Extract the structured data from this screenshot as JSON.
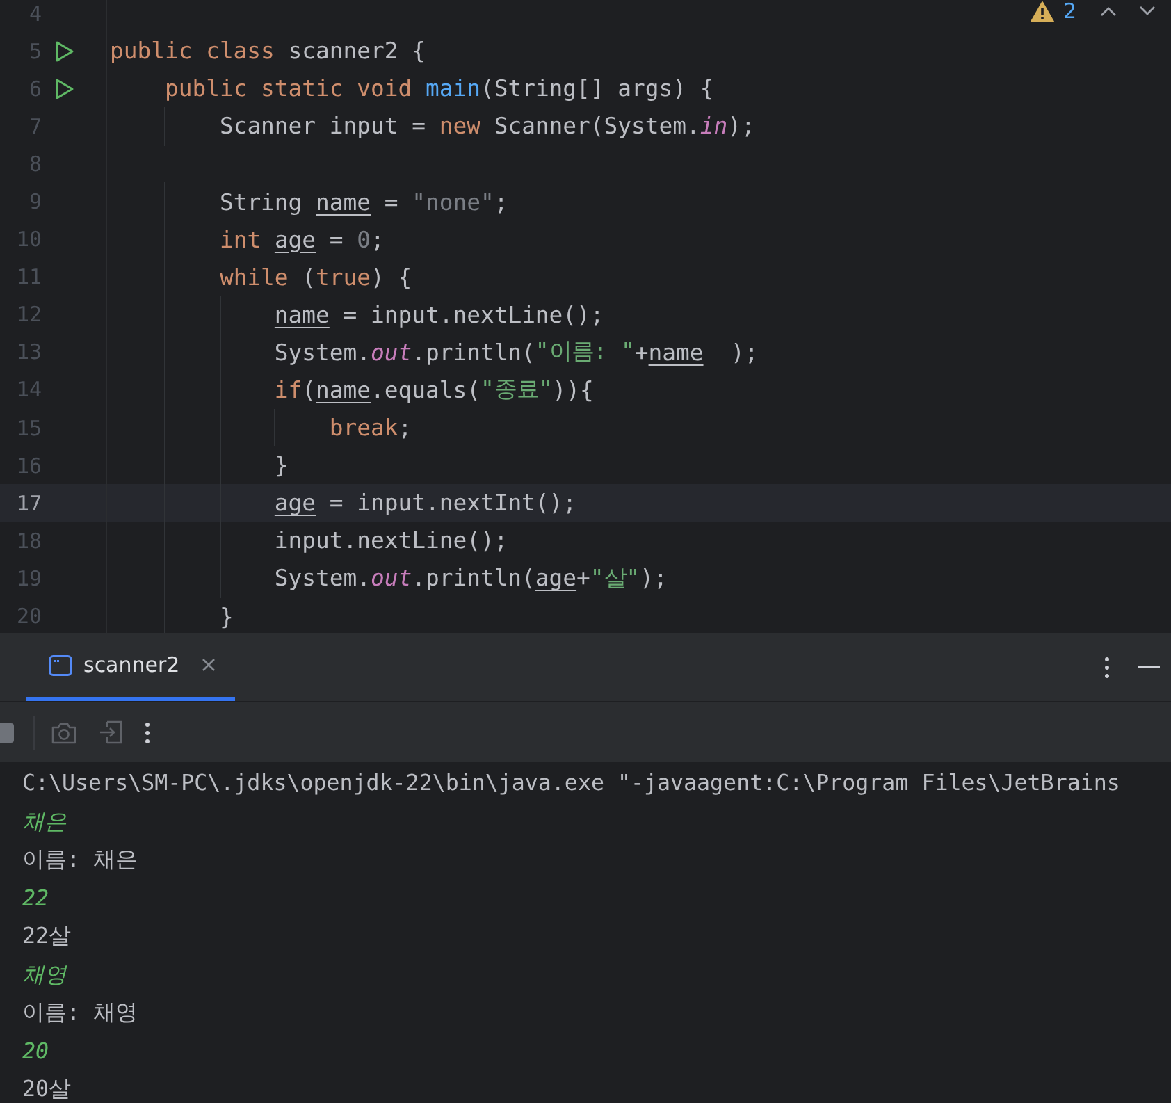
{
  "editor": {
    "inspections": {
      "warnings": "2"
    },
    "lines": [
      {
        "n": "4",
        "run": false,
        "current": false
      },
      {
        "n": "5",
        "run": true,
        "current": false,
        "tokens": [
          {
            "t": "public class ",
            "kind": "kw"
          },
          {
            "t": "scanner2 {",
            "kind": "plain"
          }
        ]
      },
      {
        "n": "6",
        "run": true,
        "current": false,
        "tokens": [
          {
            "t": "    public static void ",
            "kind": "kw"
          },
          {
            "t": "main",
            "kind": "fn"
          },
          {
            "t": "(String[] args) {",
            "kind": "plain"
          }
        ]
      },
      {
        "n": "7",
        "run": false,
        "current": false,
        "tokens": [
          {
            "t": "        Scanner input = ",
            "kind": "plain"
          },
          {
            "t": "new ",
            "kind": "kw"
          },
          {
            "t": "Scanner(System.",
            "kind": "plain"
          },
          {
            "t": "in",
            "kind": "static"
          },
          {
            "t": ");",
            "kind": "plain"
          }
        ]
      },
      {
        "n": "8",
        "run": false,
        "current": false
      },
      {
        "n": "9",
        "run": false,
        "current": false,
        "tokens": [
          {
            "t": "        String ",
            "kind": "plain"
          },
          {
            "t": "name",
            "kind": "var"
          },
          {
            "t": " = ",
            "kind": "plain"
          },
          {
            "t": "\"none\"",
            "kind": "unused"
          },
          {
            "t": ";",
            "kind": "plain"
          }
        ]
      },
      {
        "n": "10",
        "run": false,
        "current": false,
        "tokens": [
          {
            "t": "        int ",
            "kind": "kw"
          },
          {
            "t": "age",
            "kind": "var"
          },
          {
            "t": " = ",
            "kind": "plain"
          },
          {
            "t": "0",
            "kind": "unused"
          },
          {
            "t": ";",
            "kind": "plain"
          }
        ]
      },
      {
        "n": "11",
        "run": false,
        "current": false,
        "tokens": [
          {
            "t": "        while ",
            "kind": "kw"
          },
          {
            "t": "(",
            "kind": "plain"
          },
          {
            "t": "true",
            "kind": "kw"
          },
          {
            "t": ") {",
            "kind": "plain"
          }
        ]
      },
      {
        "n": "12",
        "run": false,
        "current": false,
        "tokens": [
          {
            "t": "            name",
            "kind": "var"
          },
          {
            "t": " = input.nextLine();",
            "kind": "plain"
          }
        ]
      },
      {
        "n": "13",
        "run": false,
        "current": false,
        "tokens": [
          {
            "t": "            System.",
            "kind": "plain"
          },
          {
            "t": "out",
            "kind": "static"
          },
          {
            "t": ".println(",
            "kind": "plain"
          },
          {
            "t": "\"이름: \"",
            "kind": "str"
          },
          {
            "t": "+",
            "kind": "plain"
          },
          {
            "t": "name",
            "kind": "var"
          },
          {
            "t": "  );",
            "kind": "plain"
          }
        ]
      },
      {
        "n": "14",
        "run": false,
        "current": false,
        "tokens": [
          {
            "t": "            if",
            "kind": "kw"
          },
          {
            "t": "(",
            "kind": "plain"
          },
          {
            "t": "name",
            "kind": "var"
          },
          {
            "t": ".equals(",
            "kind": "plain"
          },
          {
            "t": "\"종료\"",
            "kind": "str"
          },
          {
            "t": ")){",
            "kind": "plain"
          }
        ]
      },
      {
        "n": "15",
        "run": false,
        "current": false,
        "tokens": [
          {
            "t": "                break",
            "kind": "kw"
          },
          {
            "t": ";",
            "kind": "plain"
          }
        ]
      },
      {
        "n": "16",
        "run": false,
        "current": false,
        "tokens": [
          {
            "t": "            }",
            "kind": "plain"
          }
        ]
      },
      {
        "n": "17",
        "run": false,
        "current": true,
        "tokens": [
          {
            "t": "            age",
            "kind": "var"
          },
          {
            "t": " = input.nextInt();",
            "kind": "plain"
          }
        ]
      },
      {
        "n": "18",
        "run": false,
        "current": false,
        "tokens": [
          {
            "t": "            input.nextLine();",
            "kind": "plain"
          }
        ]
      },
      {
        "n": "19",
        "run": false,
        "current": false,
        "tokens": [
          {
            "t": "            System.",
            "kind": "plain"
          },
          {
            "t": "out",
            "kind": "static"
          },
          {
            "t": ".println(",
            "kind": "plain"
          },
          {
            "t": "age",
            "kind": "var"
          },
          {
            "t": "+",
            "kind": "plain"
          },
          {
            "t": "\"살\"",
            "kind": "str"
          },
          {
            "t": ");",
            "kind": "plain"
          }
        ]
      },
      {
        "n": "20",
        "run": false,
        "current": false,
        "tokens": [
          {
            "t": "        }",
            "kind": "plain"
          }
        ]
      }
    ]
  },
  "run_panel": {
    "tabs": [
      {
        "label": "scanner2",
        "selected": true
      }
    ],
    "console": [
      {
        "kind": "output",
        "text": "C:\\Users\\SM-PC\\.jdks\\openjdk-22\\bin\\java.exe \"-javaagent:C:\\Program Files\\JetBrains"
      },
      {
        "kind": "input",
        "text": "채은"
      },
      {
        "kind": "output",
        "text": "이름: 채은"
      },
      {
        "kind": "input",
        "text": "22"
      },
      {
        "kind": "output",
        "text": "22살"
      },
      {
        "kind": "input",
        "text": "채영"
      },
      {
        "kind": "output",
        "text": "이름: 채영"
      },
      {
        "kind": "input",
        "text": "20"
      },
      {
        "kind": "output",
        "text": "20살"
      }
    ]
  }
}
